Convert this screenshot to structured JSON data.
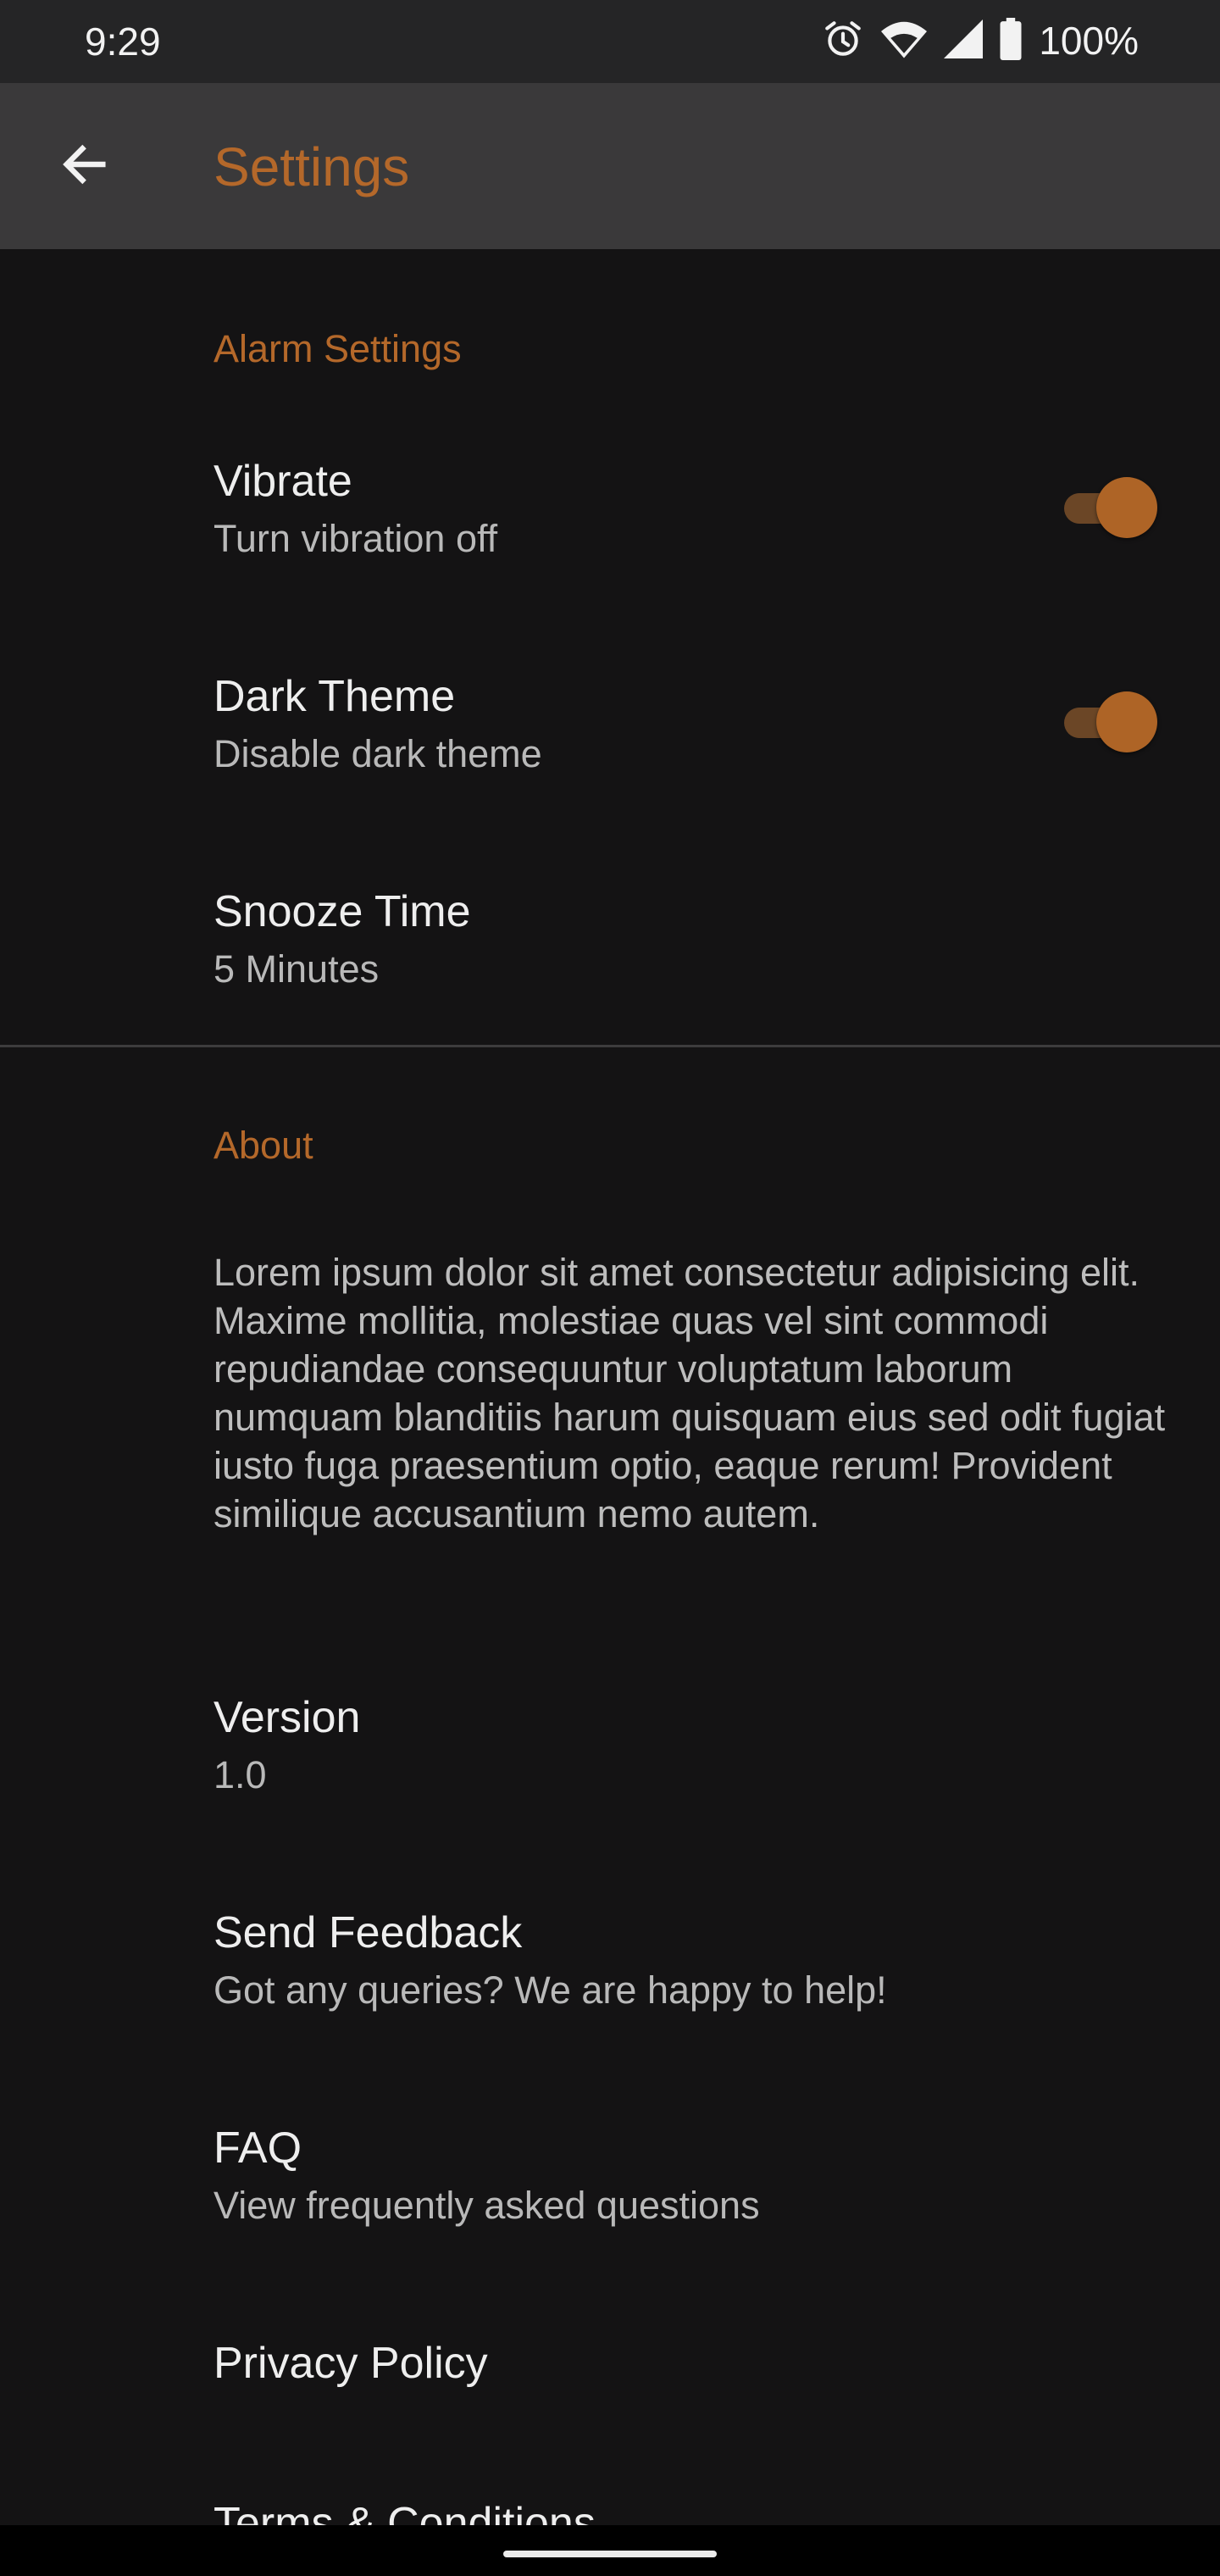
{
  "status_bar": {
    "time": "9:29",
    "battery_percent": "100%",
    "icons": [
      "alarm-icon",
      "wifi-icon",
      "signal-icon",
      "battery-icon"
    ]
  },
  "app_bar": {
    "title": "Settings",
    "back_icon": "arrow-back-icon"
  },
  "alarm_section": {
    "header": "Alarm Settings",
    "vibrate": {
      "title": "Vibrate",
      "summary": "Turn vibration off",
      "on": true
    },
    "dark_theme": {
      "title": "Dark Theme",
      "summary": "Disable dark theme",
      "on": true
    },
    "snooze": {
      "title": "Snooze Time",
      "summary": "5 Minutes"
    }
  },
  "about_section": {
    "header": "About",
    "description": "Lorem ipsum dolor sit amet consectetur adipisicing elit. Maxime mollitia, molestiae quas vel sint commodi repudiandae consequuntur voluptatum laborum numquam blanditiis harum quisquam eius sed odit fugiat iusto fuga praesentium optio, eaque rerum! Provident similique accusantium nemo autem.",
    "version": {
      "title": "Version",
      "summary": "1.0"
    },
    "feedback": {
      "title": "Send Feedback",
      "summary": "Got any queries? We are happy to help!"
    },
    "faq": {
      "title": "FAQ",
      "summary": "View frequently asked questions"
    },
    "privacy": {
      "title": "Privacy Policy"
    },
    "terms": {
      "title": "Terms & Conditions"
    }
  },
  "colors": {
    "accent": "#B4682A",
    "background": "#141314",
    "app_bar": "#3A393A",
    "status_bar": "#252526"
  }
}
